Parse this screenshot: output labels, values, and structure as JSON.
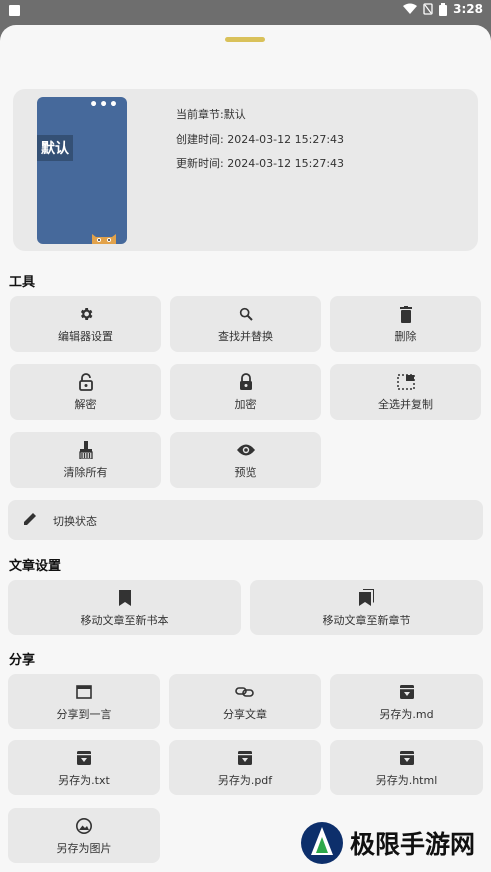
{
  "status": {
    "time": "3:28"
  },
  "info": {
    "cover_title": "默认",
    "current_chapter": "当前章节:默认",
    "created": "创建时间: 2024-03-12 15:27:43",
    "updated": "更新时间: 2024-03-12 15:27:43"
  },
  "sections": {
    "tools": "工具",
    "article_settings": "文章设置",
    "share": "分享"
  },
  "tools": {
    "editor_settings": "编辑器设置",
    "find_replace": "查找并替换",
    "delete": "删除",
    "decrypt": "解密",
    "encrypt": "加密",
    "select_all_copy": "全选并复制",
    "clear_all": "清除所有",
    "preview": "预览",
    "toggle_state": "切换状态"
  },
  "article": {
    "move_to_book": "移动文章至新书本",
    "move_to_chapter": "移动文章至新章节"
  },
  "share": {
    "to_yiyan": "分享到一言",
    "share_article": "分享文章",
    "save_md": "另存为.md",
    "save_txt": "另存为.txt",
    "save_pdf": "另存为.pdf",
    "save_html": "另存为.html",
    "save_image": "另存为图片"
  },
  "watermark": {
    "text": "极限手游网"
  },
  "colors": {
    "cover": "#46699b",
    "handle": "#d9c15a",
    "tile": "#e8e8e8"
  }
}
